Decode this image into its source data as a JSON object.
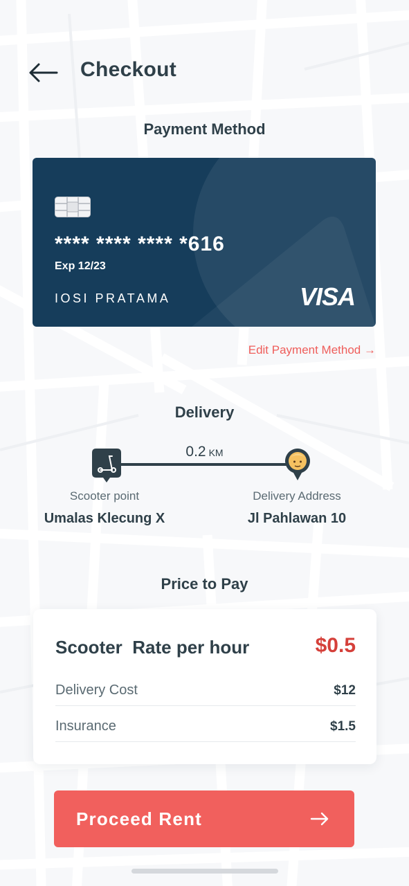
{
  "header": {
    "title": "Checkout",
    "back_icon": "arrow-left-icon"
  },
  "payment": {
    "section_title": "Payment Method",
    "card": {
      "number": "**** **** **** *616",
      "exp": "Exp 12/23",
      "holder": "IOSI PRATAMA",
      "brand": "VISA",
      "chip_icon": "card-chip-icon"
    },
    "edit_label": "Edit Payment Method →"
  },
  "delivery": {
    "section_title": "Delivery",
    "distance_value": "0.2",
    "distance_unit": "KM",
    "origin": {
      "label": "Scooter point",
      "name": "Umalas Klecung X",
      "icon": "scooter-pin-icon"
    },
    "destination": {
      "label": "Delivery Address",
      "name": "Jl Pahlawan 10",
      "icon": "user-avatar-pin-icon"
    }
  },
  "price": {
    "section_title": "Price to Pay",
    "rate_label": "Scooter  Rate per hour",
    "rate_value": "$0.5",
    "items": [
      {
        "label": "Delivery Cost",
        "amount": "$12"
      },
      {
        "label": "Insurance",
        "amount": "$1.5"
      }
    ]
  },
  "cta": {
    "label": "Proceed Rent",
    "icon": "arrow-right-icon"
  },
  "colors": {
    "primary": "#f1605d",
    "card": "#163d5b",
    "text": "#2f4049",
    "accent_red": "#d5403a"
  }
}
